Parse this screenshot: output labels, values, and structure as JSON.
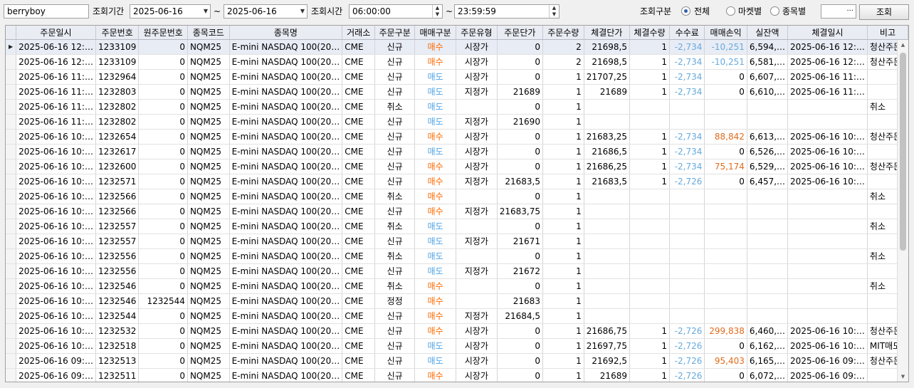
{
  "filters": {
    "account": "berryboy",
    "period_label": "조회기간",
    "date_from": "2025-06-16",
    "tilde": "~",
    "date_to": "2025-06-16",
    "time_label": "조회시간",
    "time_from": "06:00:00",
    "time_to": "23:59:59",
    "scope_label": "조회구분",
    "scope_options": [
      "전체",
      "마켓별",
      "종목별"
    ],
    "scope_selected": "전체",
    "extra_value": "",
    "more_label": "···",
    "search_label": "조회"
  },
  "table": {
    "columns": [
      "주문일시",
      "주문번호",
      "원주문번호",
      "종목코드",
      "종목명",
      "거래소",
      "주문구분",
      "매매구분",
      "주문유형",
      "주문단가",
      "주문수량",
      "체결단가",
      "체결수량",
      "수수료",
      "매매손익",
      "실잔액",
      "체결일시",
      "비고"
    ],
    "rows": [
      [
        "2025-06-16 12:…",
        "1233109",
        "0",
        "NQM25",
        "E-mini NASDAQ 100(20…",
        "CME",
        "신규",
        "매수",
        "시장가",
        "0",
        "2",
        "21698,5",
        "1",
        "-2,734",
        "-10,251",
        "6,594,…",
        "2025-06-16 12:…",
        "청산주문"
      ],
      [
        "2025-06-16 12:…",
        "1233109",
        "0",
        "NQM25",
        "E-mini NASDAQ 100(20…",
        "CME",
        "신규",
        "매수",
        "시장가",
        "0",
        "2",
        "21698,5",
        "1",
        "-2,734",
        "-10,251",
        "6,581,…",
        "2025-06-16 12:…",
        "청산주문"
      ],
      [
        "2025-06-16 11:…",
        "1232964",
        "0",
        "NQM25",
        "E-mini NASDAQ 100(20…",
        "CME",
        "신규",
        "매도",
        "시장가",
        "0",
        "1",
        "21707,25",
        "1",
        "-2,734",
        "0",
        "6,607,…",
        "2025-06-16 11:…",
        ""
      ],
      [
        "2025-06-16 11:…",
        "1232803",
        "0",
        "NQM25",
        "E-mini NASDAQ 100(20…",
        "CME",
        "신규",
        "매도",
        "지정가",
        "21689",
        "1",
        "21689",
        "1",
        "-2,734",
        "0",
        "6,610,…",
        "2025-06-16 11:…",
        ""
      ],
      [
        "2025-06-16 11:…",
        "1232802",
        "0",
        "NQM25",
        "E-mini NASDAQ 100(20…",
        "CME",
        "취소",
        "매도",
        "",
        "0",
        "1",
        "",
        "",
        "",
        "",
        "",
        "",
        "취소"
      ],
      [
        "2025-06-16 11:…",
        "1232802",
        "0",
        "NQM25",
        "E-mini NASDAQ 100(20…",
        "CME",
        "신규",
        "매도",
        "지정가",
        "21690",
        "1",
        "",
        "",
        "",
        "",
        "",
        "",
        ""
      ],
      [
        "2025-06-16 10:…",
        "1232654",
        "0",
        "NQM25",
        "E-mini NASDAQ 100(20…",
        "CME",
        "신규",
        "매수",
        "시장가",
        "0",
        "1",
        "21683,25",
        "1",
        "-2,734",
        "88,842",
        "6,613,…",
        "2025-06-16 10:…",
        "청산주문"
      ],
      [
        "2025-06-16 10:…",
        "1232617",
        "0",
        "NQM25",
        "E-mini NASDAQ 100(20…",
        "CME",
        "신규",
        "매도",
        "시장가",
        "0",
        "1",
        "21686,5",
        "1",
        "-2,734",
        "0",
        "6,526,…",
        "2025-06-16 10:…",
        ""
      ],
      [
        "2025-06-16 10:…",
        "1232600",
        "0",
        "NQM25",
        "E-mini NASDAQ 100(20…",
        "CME",
        "신규",
        "매수",
        "시장가",
        "0",
        "1",
        "21686,25",
        "1",
        "-2,734",
        "75,174",
        "6,529,…",
        "2025-06-16 10:…",
        "청산주문"
      ],
      [
        "2025-06-16 10:…",
        "1232571",
        "0",
        "NQM25",
        "E-mini NASDAQ 100(20…",
        "CME",
        "신규",
        "매수",
        "지정가",
        "21683,5",
        "1",
        "21683,5",
        "1",
        "-2,726",
        "0",
        "6,457,…",
        "2025-06-16 10:…",
        ""
      ],
      [
        "2025-06-16 10:…",
        "1232566",
        "0",
        "NQM25",
        "E-mini NASDAQ 100(20…",
        "CME",
        "취소",
        "매수",
        "",
        "0",
        "1",
        "",
        "",
        "",
        "",
        "",
        "",
        "취소"
      ],
      [
        "2025-06-16 10:…",
        "1232566",
        "0",
        "NQM25",
        "E-mini NASDAQ 100(20…",
        "CME",
        "신규",
        "매수",
        "지정가",
        "21683,75",
        "1",
        "",
        "",
        "",
        "",
        "",
        "",
        ""
      ],
      [
        "2025-06-16 10:…",
        "1232557",
        "0",
        "NQM25",
        "E-mini NASDAQ 100(20…",
        "CME",
        "취소",
        "매도",
        "",
        "0",
        "1",
        "",
        "",
        "",
        "",
        "",
        "",
        "취소"
      ],
      [
        "2025-06-16 10:…",
        "1232557",
        "0",
        "NQM25",
        "E-mini NASDAQ 100(20…",
        "CME",
        "신규",
        "매도",
        "지정가",
        "21671",
        "1",
        "",
        "",
        "",
        "",
        "",
        "",
        ""
      ],
      [
        "2025-06-16 10:…",
        "1232556",
        "0",
        "NQM25",
        "E-mini NASDAQ 100(20…",
        "CME",
        "취소",
        "매도",
        "",
        "0",
        "1",
        "",
        "",
        "",
        "",
        "",
        "",
        "취소"
      ],
      [
        "2025-06-16 10:…",
        "1232556",
        "0",
        "NQM25",
        "E-mini NASDAQ 100(20…",
        "CME",
        "신규",
        "매도",
        "지정가",
        "21672",
        "1",
        "",
        "",
        "",
        "",
        "",
        "",
        ""
      ],
      [
        "2025-06-16 10:…",
        "1232546",
        "0",
        "NQM25",
        "E-mini NASDAQ 100(20…",
        "CME",
        "취소",
        "매수",
        "",
        "0",
        "1",
        "",
        "",
        "",
        "",
        "",
        "",
        "취소"
      ],
      [
        "2025-06-16 10:…",
        "1232546",
        "1232544",
        "NQM25",
        "E-mini NASDAQ 100(20…",
        "CME",
        "정정",
        "매수",
        "",
        "21683",
        "1",
        "",
        "",
        "",
        "",
        "",
        "",
        ""
      ],
      [
        "2025-06-16 10:…",
        "1232544",
        "0",
        "NQM25",
        "E-mini NASDAQ 100(20…",
        "CME",
        "신규",
        "매수",
        "지정가",
        "21684,5",
        "1",
        "",
        "",
        "",
        "",
        "",
        "",
        ""
      ],
      [
        "2025-06-16 10:…",
        "1232532",
        "0",
        "NQM25",
        "E-mini NASDAQ 100(20…",
        "CME",
        "신규",
        "매수",
        "시장가",
        "0",
        "1",
        "21686,75",
        "1",
        "-2,726",
        "299,838",
        "6,460,…",
        "2025-06-16 10:…",
        "청산주문"
      ],
      [
        "2025-06-16 10:…",
        "1232518",
        "0",
        "NQM25",
        "E-mini NASDAQ 100(20…",
        "CME",
        "신규",
        "매도",
        "시장가",
        "0",
        "1",
        "21697,75",
        "1",
        "-2,726",
        "0",
        "6,162,…",
        "2025-06-16 10:…",
        "MIT매도"
      ],
      [
        "2025-06-16 09:…",
        "1232513",
        "0",
        "NQM25",
        "E-mini NASDAQ 100(20…",
        "CME",
        "신규",
        "매도",
        "시장가",
        "0",
        "1",
        "21692,5",
        "1",
        "-2,726",
        "95,403",
        "6,165,…",
        "2025-06-16 09:…",
        "청산주문"
      ],
      [
        "2025-06-16 09:…",
        "1232511",
        "0",
        "NQM25",
        "E-mini NASDAQ 100(20…",
        "CME",
        "신규",
        "매수",
        "시장가",
        "0",
        "1",
        "21689",
        "1",
        "-2,726",
        "0",
        "6,072,…",
        "2025-06-16 09:…",
        ""
      ]
    ]
  },
  "colors": {
    "buy": "#ff6a00",
    "sell": "#4fa3e6",
    "fee_negative": "#66aadd",
    "pnl_positive": "#e06b1b",
    "header_bg": "#e9ecf3",
    "selected_row_bg": "#e8ecf5"
  },
  "selected_row_index": 0
}
